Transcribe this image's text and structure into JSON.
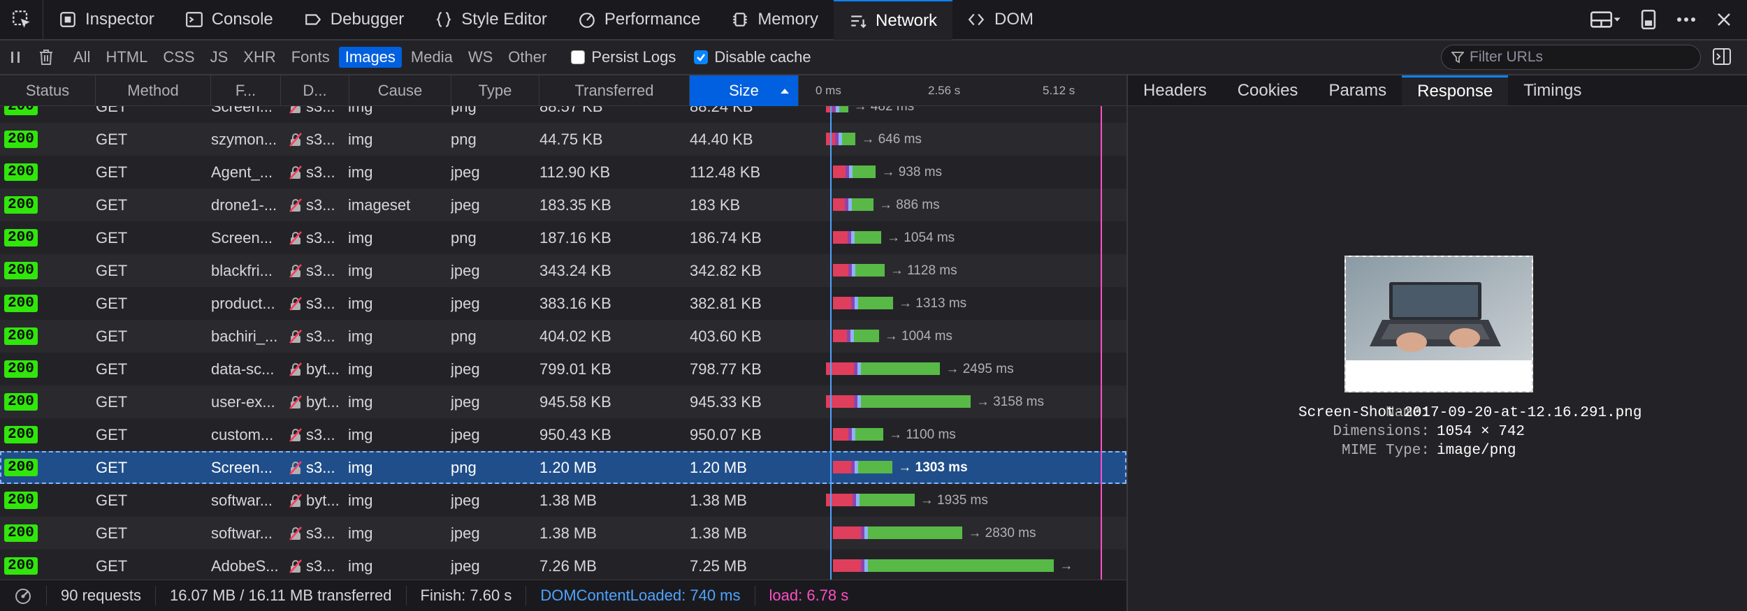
{
  "toolbox": {
    "tabs": [
      {
        "label": "Inspector",
        "icon": "inspector-icon"
      },
      {
        "label": "Console",
        "icon": "console-icon"
      },
      {
        "label": "Debugger",
        "icon": "debugger-icon"
      },
      {
        "label": "Style Editor",
        "icon": "style-editor-icon"
      },
      {
        "label": "Performance",
        "icon": "performance-icon"
      },
      {
        "label": "Memory",
        "icon": "memory-icon"
      },
      {
        "label": "Network",
        "icon": "network-icon",
        "active": true
      },
      {
        "label": "DOM",
        "icon": "dom-icon"
      }
    ]
  },
  "filterbar": {
    "types": [
      "All",
      "HTML",
      "CSS",
      "JS",
      "XHR",
      "Fonts",
      "Images",
      "Media",
      "WS",
      "Other"
    ],
    "active_type": "Images",
    "persist_logs_label": "Persist Logs",
    "persist_logs_checked": false,
    "disable_cache_label": "Disable cache",
    "disable_cache_checked": true,
    "filter_placeholder": "Filter URLs"
  },
  "columns": {
    "status": "Status",
    "method": "Method",
    "file": "F...",
    "domain": "D...",
    "cause": "Cause",
    "type": "Type",
    "transferred": "Transferred",
    "size": "Size",
    "ticks": [
      "0 ms",
      "2.56 s",
      "5.12 s"
    ]
  },
  "colors": {
    "status_ok": "#30e60b",
    "selected_row": "#204e8a",
    "accent": "#0a84ff",
    "bar_blocked": "#e03e5d",
    "bar_dns": "#8e44ad",
    "bar_connect": "#8ab4f8",
    "bar_waiting": "#7aa84d",
    "bar_receive": "#58b947",
    "dom_content_loaded": "#4fa3ff",
    "load": "#ff4fc4"
  },
  "requests": [
    {
      "status": "200",
      "method": "GET",
      "file": "Screen...",
      "domain": "s3...",
      "cause": "img",
      "type": "png",
      "transferred": "88.57 KB",
      "size": "88.24 KB",
      "time": "→ 482 ms",
      "ms": 482,
      "start": 0
    },
    {
      "status": "200",
      "method": "GET",
      "file": "szymon...",
      "domain": "s3...",
      "cause": "img",
      "type": "png",
      "transferred": "44.75 KB",
      "size": "44.40 KB",
      "time": "→ 646 ms",
      "ms": 646,
      "start": 0
    },
    {
      "status": "200",
      "method": "GET",
      "file": "Agent_...",
      "domain": "s3...",
      "cause": "img",
      "type": "jpeg",
      "transferred": "112.90 KB",
      "size": "112.48 KB",
      "time": "→ 938 ms",
      "ms": 938,
      "start": 10
    },
    {
      "status": "200",
      "method": "GET",
      "file": "drone1-...",
      "domain": "s3...",
      "cause": "imageset",
      "type": "jpeg",
      "transferred": "183.35 KB",
      "size": "183 KB",
      "time": "→ 886 ms",
      "ms": 886,
      "start": 10
    },
    {
      "status": "200",
      "method": "GET",
      "file": "Screen...",
      "domain": "s3...",
      "cause": "img",
      "type": "png",
      "transferred": "187.16 KB",
      "size": "186.74 KB",
      "time": "→ 1054 ms",
      "ms": 1054,
      "start": 10
    },
    {
      "status": "200",
      "method": "GET",
      "file": "blackfri...",
      "domain": "s3...",
      "cause": "img",
      "type": "jpeg",
      "transferred": "343.24 KB",
      "size": "342.82 KB",
      "time": "→ 1128 ms",
      "ms": 1128,
      "start": 10
    },
    {
      "status": "200",
      "method": "GET",
      "file": "product...",
      "domain": "s3...",
      "cause": "img",
      "type": "jpeg",
      "transferred": "383.16 KB",
      "size": "382.81 KB",
      "time": "→ 1313 ms",
      "ms": 1313,
      "start": 10
    },
    {
      "status": "200",
      "method": "GET",
      "file": "bachiri_...",
      "domain": "s3...",
      "cause": "img",
      "type": "png",
      "transferred": "404.02 KB",
      "size": "403.60 KB",
      "time": "→ 1004 ms",
      "ms": 1004,
      "start": 10
    },
    {
      "status": "200",
      "method": "GET",
      "file": "data-sc...",
      "domain": "byt...",
      "cause": "img",
      "type": "jpeg",
      "transferred": "799.01 KB",
      "size": "798.77 KB",
      "time": "→ 2495 ms",
      "ms": 2495,
      "start": 0
    },
    {
      "status": "200",
      "method": "GET",
      "file": "user-ex...",
      "domain": "byt...",
      "cause": "img",
      "type": "jpeg",
      "transferred": "945.58 KB",
      "size": "945.33 KB",
      "time": "→ 3158 ms",
      "ms": 3158,
      "start": 0
    },
    {
      "status": "200",
      "method": "GET",
      "file": "custom...",
      "domain": "s3...",
      "cause": "img",
      "type": "jpeg",
      "transferred": "950.43 KB",
      "size": "950.07 KB",
      "time": "→ 1100 ms",
      "ms": 1100,
      "start": 10
    },
    {
      "status": "200",
      "method": "GET",
      "file": "Screen...",
      "domain": "s3...",
      "cause": "img",
      "type": "png",
      "transferred": "1.20 MB",
      "size": "1.20 MB",
      "time": "→ 1303 ms",
      "ms": 1303,
      "start": 10,
      "selected": true
    },
    {
      "status": "200",
      "method": "GET",
      "file": "softwar...",
      "domain": "byt...",
      "cause": "img",
      "type": "jpeg",
      "transferred": "1.38 MB",
      "size": "1.38 MB",
      "time": "→ 1935 ms",
      "ms": 1935,
      "start": 0
    },
    {
      "status": "200",
      "method": "GET",
      "file": "softwar...",
      "domain": "s3...",
      "cause": "img",
      "type": "jpeg",
      "transferred": "1.38 MB",
      "size": "1.38 MB",
      "time": "→ 2830 ms",
      "ms": 2830,
      "start": 10
    },
    {
      "status": "200",
      "method": "GET",
      "file": "AdobeS...",
      "domain": "s3...",
      "cause": "img",
      "type": "jpeg",
      "transferred": "7.26 MB",
      "size": "7.25 MB",
      "time": "→",
      "ms": 4830,
      "start": 10
    }
  ],
  "statusbar": {
    "requests": "90 requests",
    "transferred": "16.07 MB / 16.11 MB transferred",
    "finish": "Finish: 7.60 s",
    "dom_content_loaded": "DOMContentLoaded: 740 ms",
    "load": "load: 6.78 s"
  },
  "details": {
    "tabs": [
      "Headers",
      "Cookies",
      "Params",
      "Response",
      "Timings"
    ],
    "active_tab": "Response",
    "name_label": "Name:",
    "name_value": "Screen-Shot-2017-09-20-at-12.16.291.png",
    "dimensions_label": "Dimensions:",
    "dimensions_value": "1054 × 742",
    "mime_label": "MIME Type:",
    "mime_value": "image/png"
  }
}
